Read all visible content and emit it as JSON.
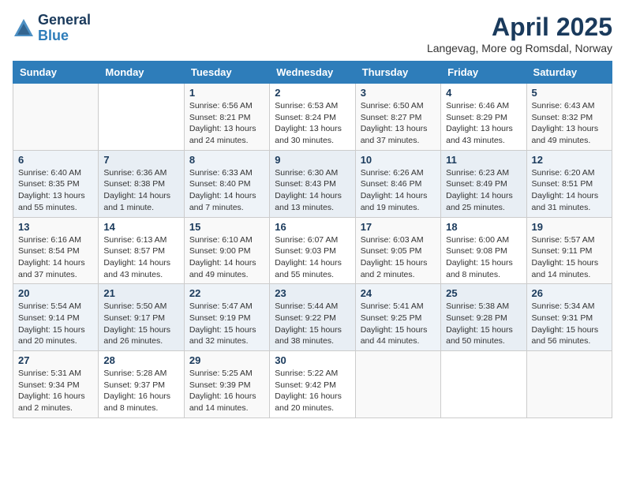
{
  "header": {
    "logo_line1": "General",
    "logo_line2": "Blue",
    "title": "April 2025",
    "subtitle": "Langevag, More og Romsdal, Norway"
  },
  "weekdays": [
    "Sunday",
    "Monday",
    "Tuesday",
    "Wednesday",
    "Thursday",
    "Friday",
    "Saturday"
  ],
  "rows": [
    [
      {
        "day": "",
        "info": ""
      },
      {
        "day": "",
        "info": ""
      },
      {
        "day": "1",
        "info": "Sunrise: 6:56 AM\nSunset: 8:21 PM\nDaylight: 13 hours\nand 24 minutes."
      },
      {
        "day": "2",
        "info": "Sunrise: 6:53 AM\nSunset: 8:24 PM\nDaylight: 13 hours\nand 30 minutes."
      },
      {
        "day": "3",
        "info": "Sunrise: 6:50 AM\nSunset: 8:27 PM\nDaylight: 13 hours\nand 37 minutes."
      },
      {
        "day": "4",
        "info": "Sunrise: 6:46 AM\nSunset: 8:29 PM\nDaylight: 13 hours\nand 43 minutes."
      },
      {
        "day": "5",
        "info": "Sunrise: 6:43 AM\nSunset: 8:32 PM\nDaylight: 13 hours\nand 49 minutes."
      }
    ],
    [
      {
        "day": "6",
        "info": "Sunrise: 6:40 AM\nSunset: 8:35 PM\nDaylight: 13 hours\nand 55 minutes."
      },
      {
        "day": "7",
        "info": "Sunrise: 6:36 AM\nSunset: 8:38 PM\nDaylight: 14 hours\nand 1 minute."
      },
      {
        "day": "8",
        "info": "Sunrise: 6:33 AM\nSunset: 8:40 PM\nDaylight: 14 hours\nand 7 minutes."
      },
      {
        "day": "9",
        "info": "Sunrise: 6:30 AM\nSunset: 8:43 PM\nDaylight: 14 hours\nand 13 minutes."
      },
      {
        "day": "10",
        "info": "Sunrise: 6:26 AM\nSunset: 8:46 PM\nDaylight: 14 hours\nand 19 minutes."
      },
      {
        "day": "11",
        "info": "Sunrise: 6:23 AM\nSunset: 8:49 PM\nDaylight: 14 hours\nand 25 minutes."
      },
      {
        "day": "12",
        "info": "Sunrise: 6:20 AM\nSunset: 8:51 PM\nDaylight: 14 hours\nand 31 minutes."
      }
    ],
    [
      {
        "day": "13",
        "info": "Sunrise: 6:16 AM\nSunset: 8:54 PM\nDaylight: 14 hours\nand 37 minutes."
      },
      {
        "day": "14",
        "info": "Sunrise: 6:13 AM\nSunset: 8:57 PM\nDaylight: 14 hours\nand 43 minutes."
      },
      {
        "day": "15",
        "info": "Sunrise: 6:10 AM\nSunset: 9:00 PM\nDaylight: 14 hours\nand 49 minutes."
      },
      {
        "day": "16",
        "info": "Sunrise: 6:07 AM\nSunset: 9:03 PM\nDaylight: 14 hours\nand 55 minutes."
      },
      {
        "day": "17",
        "info": "Sunrise: 6:03 AM\nSunset: 9:05 PM\nDaylight: 15 hours\nand 2 minutes."
      },
      {
        "day": "18",
        "info": "Sunrise: 6:00 AM\nSunset: 9:08 PM\nDaylight: 15 hours\nand 8 minutes."
      },
      {
        "day": "19",
        "info": "Sunrise: 5:57 AM\nSunset: 9:11 PM\nDaylight: 15 hours\nand 14 minutes."
      }
    ],
    [
      {
        "day": "20",
        "info": "Sunrise: 5:54 AM\nSunset: 9:14 PM\nDaylight: 15 hours\nand 20 minutes."
      },
      {
        "day": "21",
        "info": "Sunrise: 5:50 AM\nSunset: 9:17 PM\nDaylight: 15 hours\nand 26 minutes."
      },
      {
        "day": "22",
        "info": "Sunrise: 5:47 AM\nSunset: 9:19 PM\nDaylight: 15 hours\nand 32 minutes."
      },
      {
        "day": "23",
        "info": "Sunrise: 5:44 AM\nSunset: 9:22 PM\nDaylight: 15 hours\nand 38 minutes."
      },
      {
        "day": "24",
        "info": "Sunrise: 5:41 AM\nSunset: 9:25 PM\nDaylight: 15 hours\nand 44 minutes."
      },
      {
        "day": "25",
        "info": "Sunrise: 5:38 AM\nSunset: 9:28 PM\nDaylight: 15 hours\nand 50 minutes."
      },
      {
        "day": "26",
        "info": "Sunrise: 5:34 AM\nSunset: 9:31 PM\nDaylight: 15 hours\nand 56 minutes."
      }
    ],
    [
      {
        "day": "27",
        "info": "Sunrise: 5:31 AM\nSunset: 9:34 PM\nDaylight: 16 hours\nand 2 minutes."
      },
      {
        "day": "28",
        "info": "Sunrise: 5:28 AM\nSunset: 9:37 PM\nDaylight: 16 hours\nand 8 minutes."
      },
      {
        "day": "29",
        "info": "Sunrise: 5:25 AM\nSunset: 9:39 PM\nDaylight: 16 hours\nand 14 minutes."
      },
      {
        "day": "30",
        "info": "Sunrise: 5:22 AM\nSunset: 9:42 PM\nDaylight: 16 hours\nand 20 minutes."
      },
      {
        "day": "",
        "info": ""
      },
      {
        "day": "",
        "info": ""
      },
      {
        "day": "",
        "info": ""
      }
    ]
  ]
}
